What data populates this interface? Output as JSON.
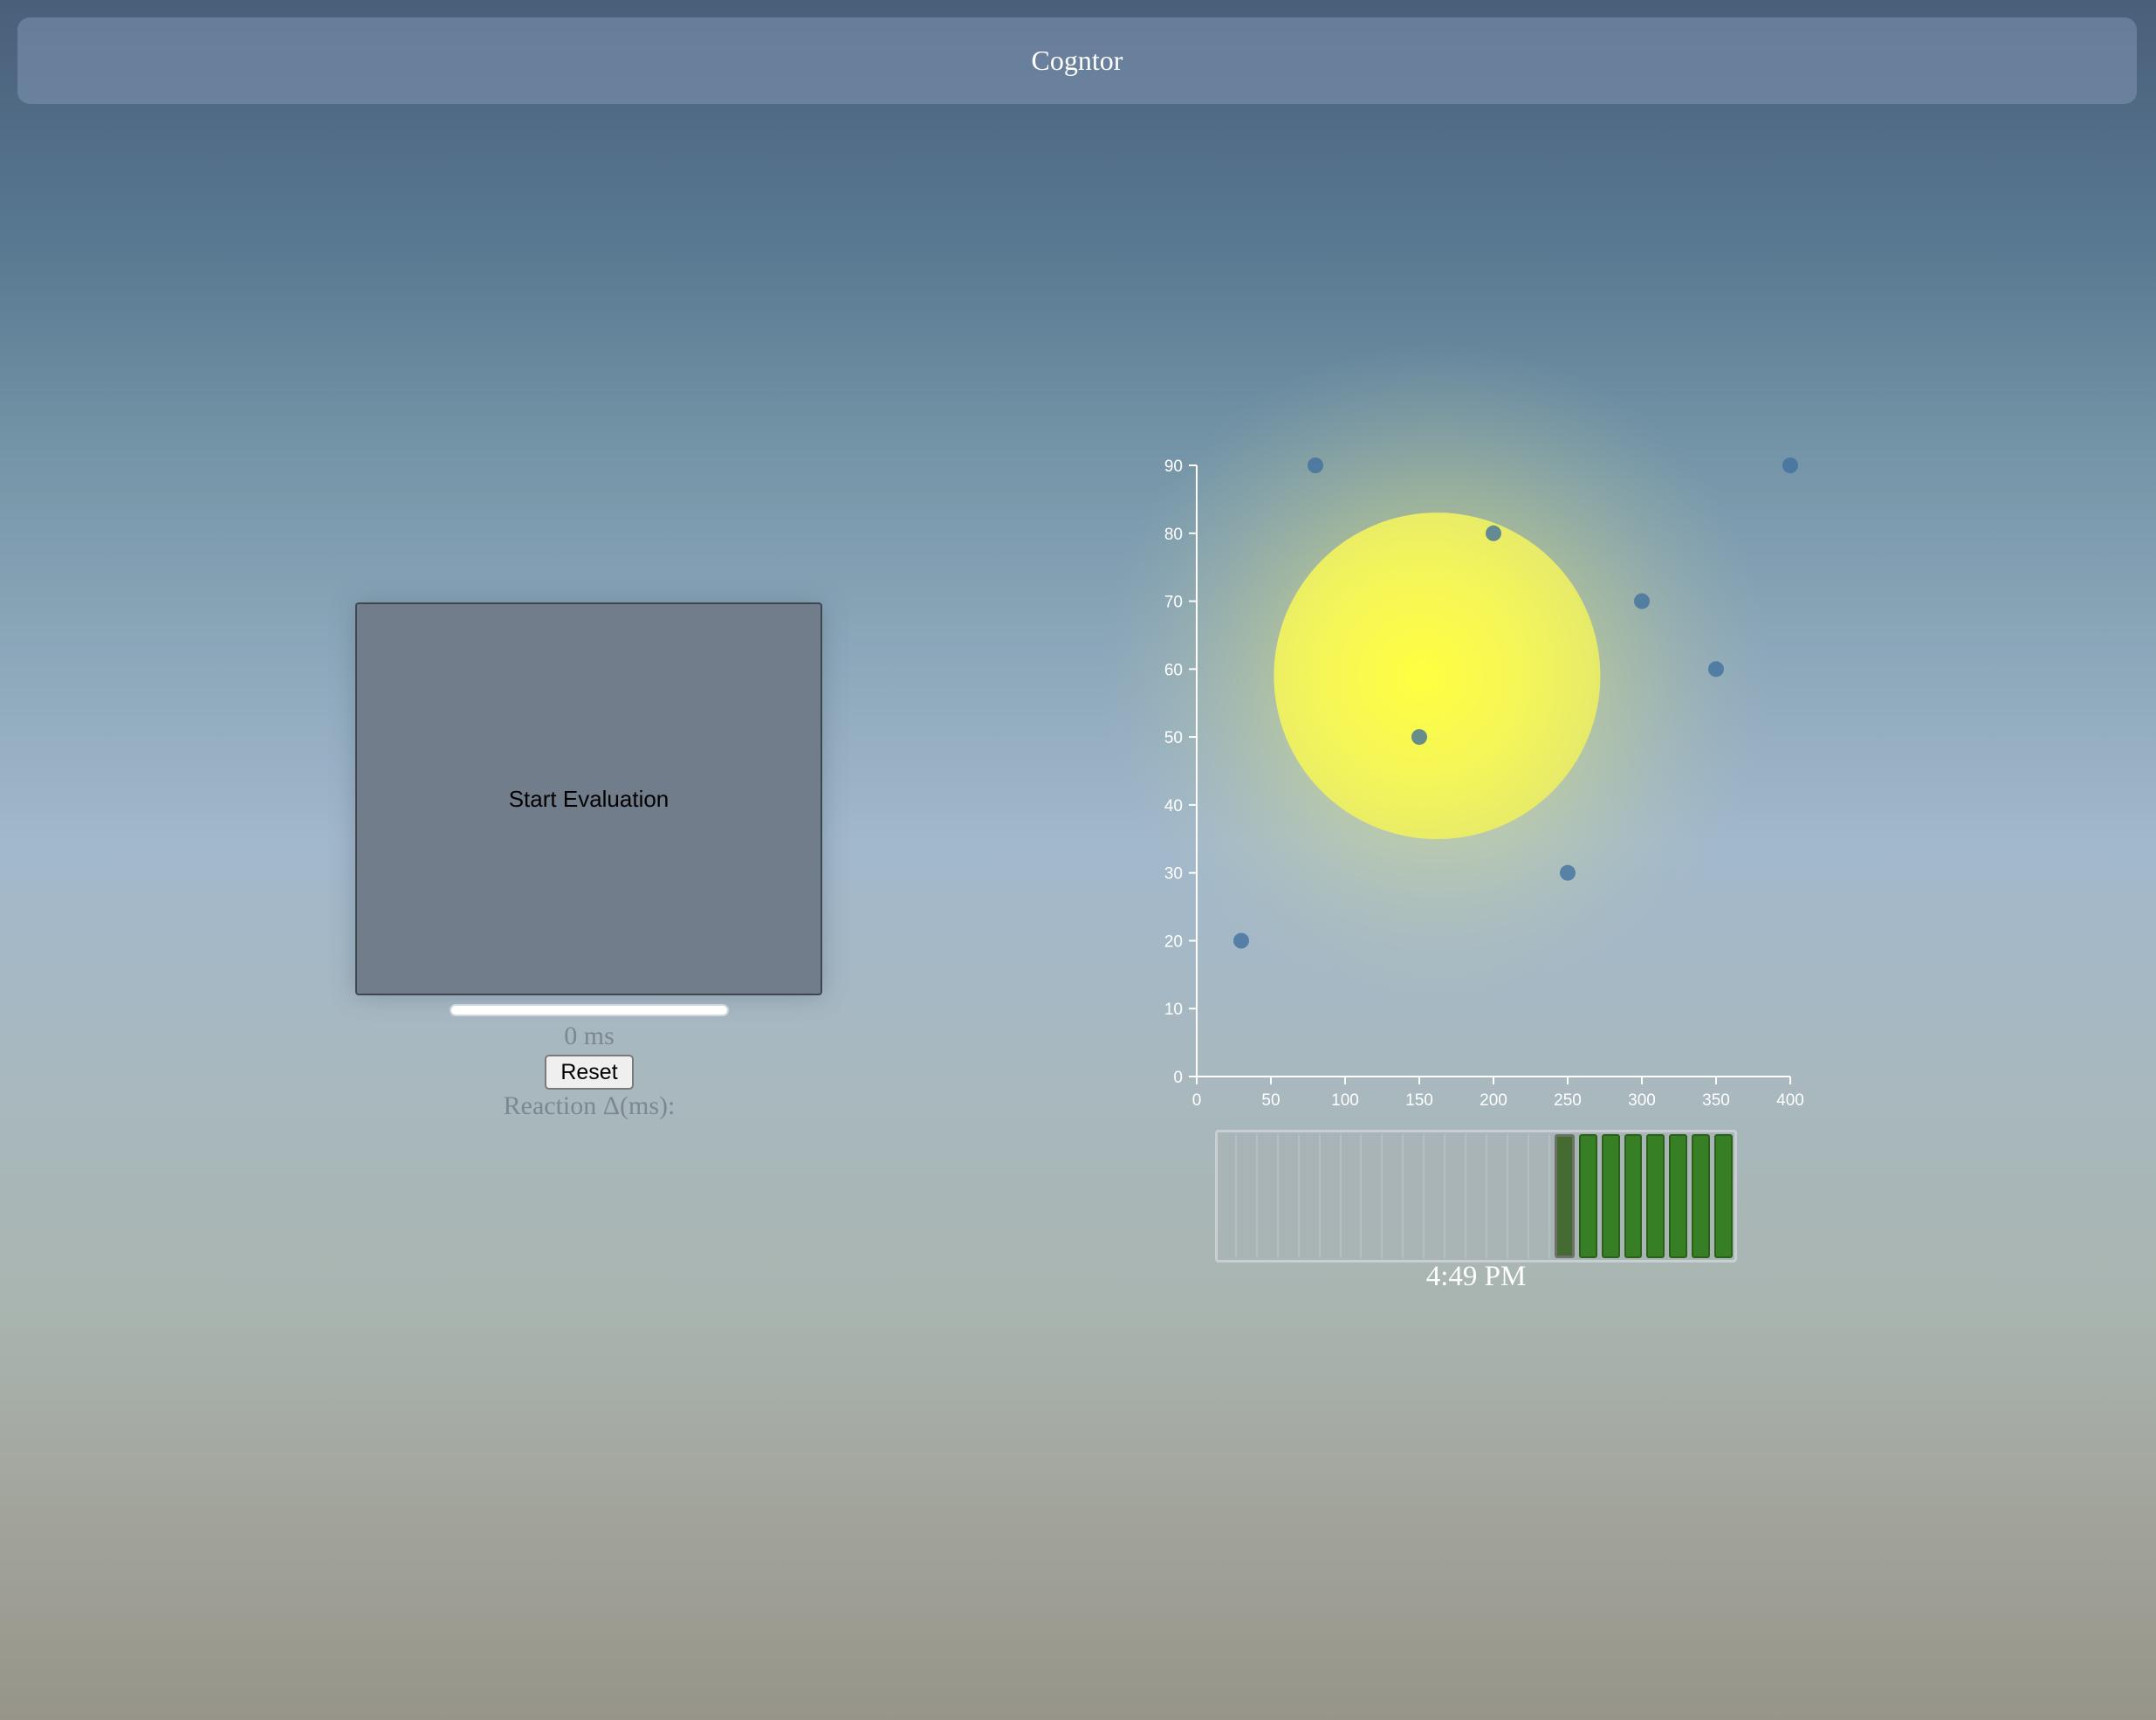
{
  "header": {
    "title": "Cogntor"
  },
  "evaluation": {
    "start_label": "Start Evaluation",
    "progress": 0,
    "ms_readout": "0 ms",
    "reset_label": "Reset",
    "reaction_label": "Reaction Δ(ms):"
  },
  "chart_data": {
    "type": "scatter",
    "title": "",
    "xlabel": "",
    "ylabel": "",
    "xlim": [
      0,
      400
    ],
    "ylim": [
      0,
      90
    ],
    "xticks": [
      0,
      50,
      100,
      150,
      200,
      250,
      300,
      350,
      400
    ],
    "yticks": [
      0,
      10,
      20,
      30,
      40,
      50,
      60,
      70,
      80,
      90
    ],
    "x": [
      30,
      80,
      150,
      200,
      250,
      300,
      350,
      400
    ],
    "y": [
      20,
      90,
      50,
      80,
      30,
      70,
      60,
      90
    ],
    "point_color": "#3f6f9e",
    "grid": false,
    "sun": {
      "color": "#ffff40",
      "center_x": 162,
      "center_y": 59,
      "radius_x": 110
    }
  },
  "timeline": {
    "total_segments": 24,
    "current_segment": 16,
    "filled_color": "#377f25",
    "time": "4:49 PM"
  }
}
